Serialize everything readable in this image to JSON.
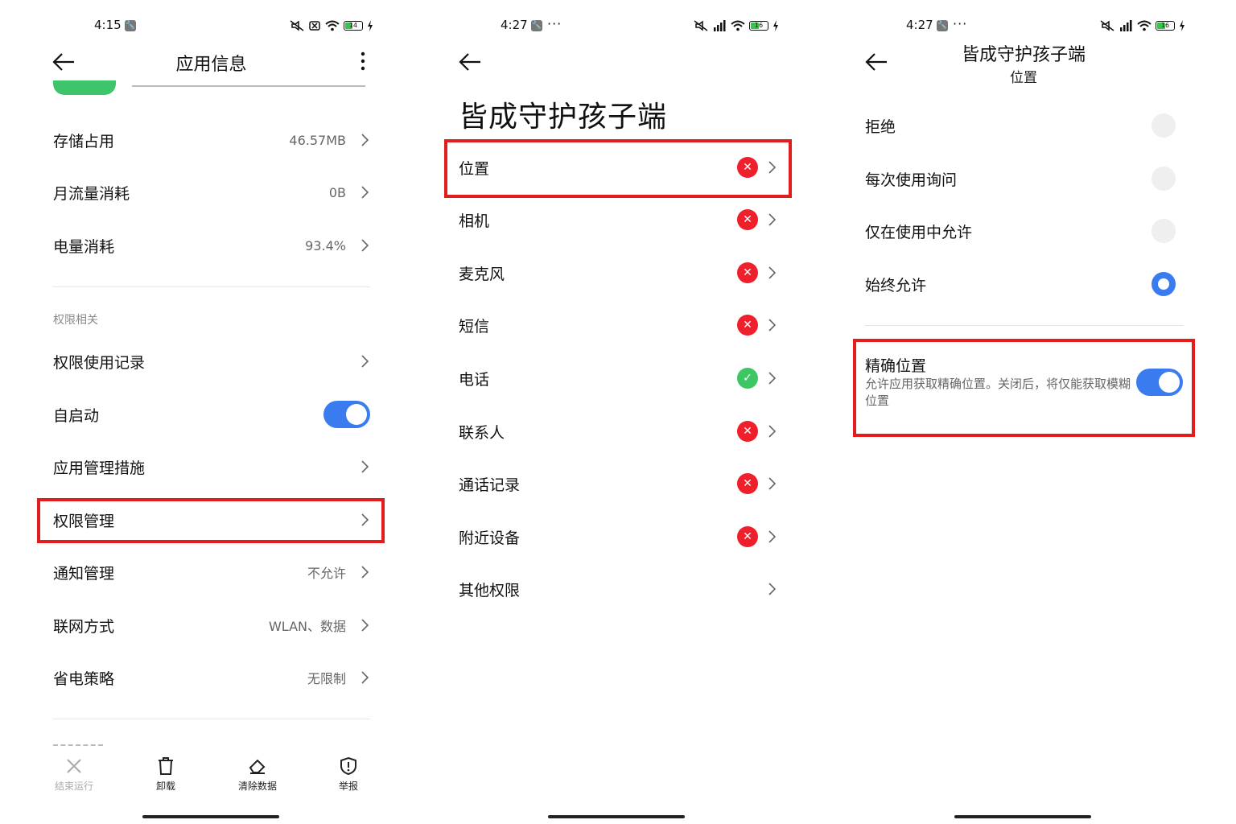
{
  "panel1": {
    "status": {
      "time": "4:15",
      "battery": "14"
    },
    "title": "应用信息",
    "rows_top": [
      {
        "label": "存储占用",
        "value": "46.57MB"
      },
      {
        "label": "月流量消耗",
        "value": "0B"
      },
      {
        "label": "电量消耗",
        "value": "93.4%"
      }
    ],
    "section_label": "权限相关",
    "rows_perm": [
      {
        "label": "权限使用记录",
        "value": ""
      },
      {
        "label": "自启动",
        "value": ""
      },
      {
        "label": "应用管理措施",
        "value": ""
      },
      {
        "label": "权限管理",
        "value": ""
      },
      {
        "label": "通知管理",
        "value": "不允许"
      },
      {
        "label": "联网方式",
        "value": "WLAN、数据"
      },
      {
        "label": "省电策略",
        "value": "无限制"
      }
    ],
    "autostart_on": true,
    "bottom_actions": [
      {
        "label": "结束运行",
        "icon": "close-icon",
        "disabled": true
      },
      {
        "label": "卸载",
        "icon": "trash-icon",
        "disabled": false
      },
      {
        "label": "清除数据",
        "icon": "eraser-icon",
        "disabled": false
      },
      {
        "label": "举报",
        "icon": "shield-alert-icon",
        "disabled": false
      }
    ]
  },
  "panel2": {
    "status": {
      "time": "4:27",
      "battery": "16"
    },
    "title": "皆成守护孩子端",
    "permissions": [
      {
        "label": "位置",
        "status": "denied"
      },
      {
        "label": "相机",
        "status": "denied"
      },
      {
        "label": "麦克风",
        "status": "denied"
      },
      {
        "label": "短信",
        "status": "denied"
      },
      {
        "label": "电话",
        "status": "allowed"
      },
      {
        "label": "联系人",
        "status": "denied"
      },
      {
        "label": "通话记录",
        "status": "denied"
      },
      {
        "label": "附近设备",
        "status": "denied"
      },
      {
        "label": "其他权限",
        "status": "none"
      }
    ]
  },
  "panel3": {
    "status": {
      "time": "4:27",
      "battery": "16"
    },
    "title": "皆成守护孩子端",
    "subtitle": "位置",
    "options": [
      {
        "label": "拒绝",
        "selected": false
      },
      {
        "label": "每次使用询问",
        "selected": false
      },
      {
        "label": "仅在使用中允许",
        "selected": false
      },
      {
        "label": "始终允许",
        "selected": true
      }
    ],
    "precise": {
      "title": "精确位置",
      "desc": "允许应用获取精确位置。关闭后，将仅能获取模糊位置",
      "on": true
    }
  },
  "colors": {
    "accent": "#3a7cf0",
    "highlight": "#e31c1c",
    "denied": "#ef1f2b",
    "allowed": "#3ec664"
  }
}
